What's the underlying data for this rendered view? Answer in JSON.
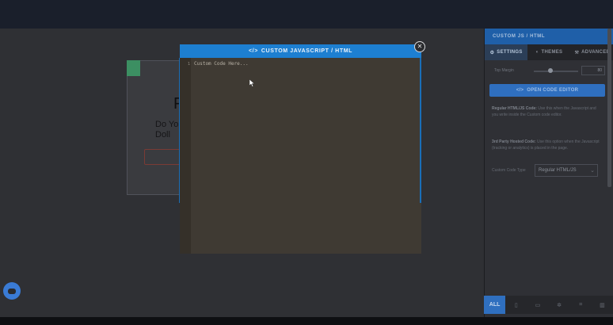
{
  "topbar": {
    "nav_left": "",
    "nav_right": ""
  },
  "preview": {
    "title": "F",
    "subtitle": "Do You Doll"
  },
  "panel": {
    "header": "CUSTOM JS / HTML",
    "tabs": [
      {
        "label": "SETTINGS",
        "icon": "gear-icon"
      },
      {
        "label": "THEMES",
        "icon": "palette-icon"
      },
      {
        "label": "ADVANCED",
        "icon": "wrench-icon"
      }
    ],
    "slider": {
      "label": "Top Margin",
      "value": "80"
    },
    "open_editor_label": "OPEN CODE EDITOR",
    "help_regular_title": "Regular HTML/JS Code:",
    "help_regular_text": "Use this when the Javascript and you write inside the Custom code editor.",
    "help_third_title": "3rd Party Hosted Code:",
    "help_third_text": "Use this option when the Javascript (tracking or analytics) is placed in the page.",
    "code_type_label": "Custom Code Type",
    "code_type_value": "Regular HTML/JS"
  },
  "footer": {
    "items": [
      "ALL",
      "",
      "",
      "",
      "",
      ""
    ]
  },
  "modal": {
    "title": "CUSTOM JAVASCRIPT / HTML",
    "line_number": "1",
    "placeholder": "Custom Code Here..."
  },
  "colors": {
    "accent": "#1d7fd1",
    "editor_bg": "#3f3a33",
    "panel_bg": "#2f3035"
  }
}
